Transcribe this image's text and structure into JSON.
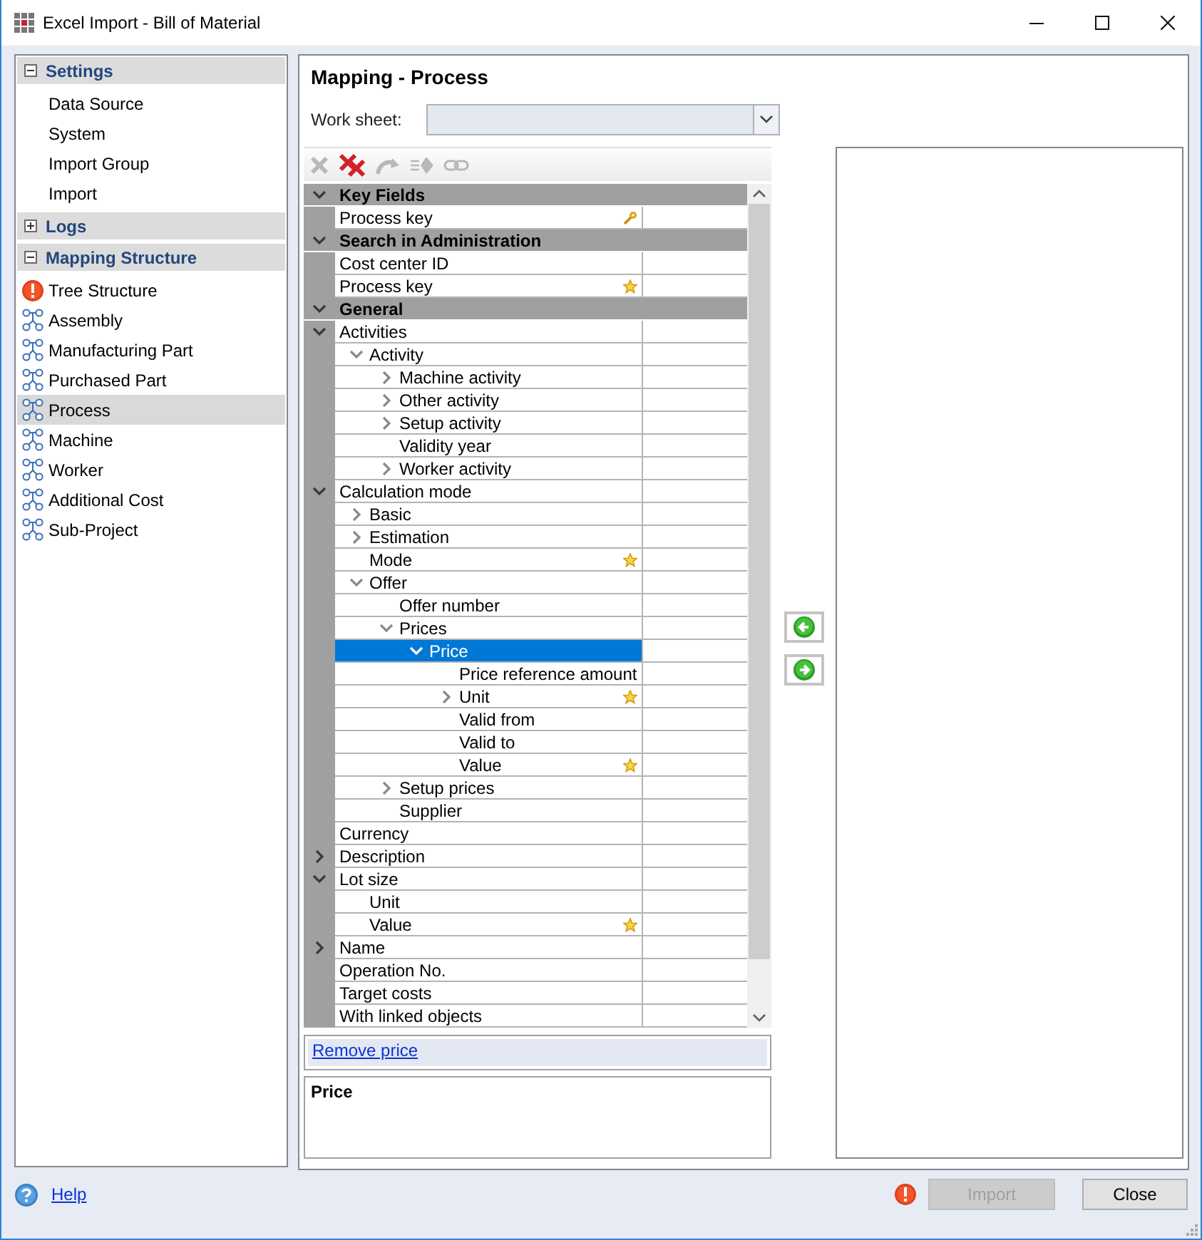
{
  "window": {
    "title": "Excel Import - Bill of Material"
  },
  "sidebar": {
    "sections": [
      {
        "title": "Settings",
        "expanded": true,
        "items": [
          {
            "label": "Data Source",
            "selected": false,
            "kind": "plain"
          },
          {
            "label": "System",
            "selected": false,
            "kind": "plain"
          },
          {
            "label": "Import Group",
            "selected": false,
            "kind": "plain"
          },
          {
            "label": "Import",
            "selected": false,
            "kind": "plain"
          }
        ]
      },
      {
        "title": "Logs",
        "expanded": false
      },
      {
        "title": "Mapping Structure",
        "expanded": true,
        "items": [
          {
            "label": "Tree Structure",
            "selected": false,
            "kind": "error"
          },
          {
            "label": "Assembly",
            "selected": false,
            "kind": "structure"
          },
          {
            "label": "Manufacturing Part",
            "selected": false,
            "kind": "structure"
          },
          {
            "label": "Purchased Part",
            "selected": false,
            "kind": "structure"
          },
          {
            "label": "Process",
            "selected": true,
            "kind": "structure"
          },
          {
            "label": "Machine",
            "selected": false,
            "kind": "structure"
          },
          {
            "label": "Worker",
            "selected": false,
            "kind": "structure"
          },
          {
            "label": "Additional Cost",
            "selected": false,
            "kind": "structure"
          },
          {
            "label": "Sub-Project",
            "selected": false,
            "kind": "structure"
          }
        ]
      }
    ]
  },
  "mapping": {
    "title": "Mapping - Process",
    "worksheet": {
      "label": "Work sheet:"
    },
    "toolbar": [
      {
        "kind": "delete",
        "disabled": true
      },
      {
        "kind": "delete-all",
        "disabled": false
      },
      {
        "kind": "undo",
        "disabled": true
      },
      {
        "kind": "assign",
        "disabled": true
      },
      {
        "kind": "link",
        "disabled": true
      }
    ],
    "groups": [
      {
        "title": "Key Fields",
        "expanded": true,
        "rows": [
          {
            "label": "Process key",
            "selected": false,
            "key_field": true
          }
        ]
      },
      {
        "title": "Search in Administration",
        "expanded": true,
        "rows": [
          {
            "label": "Cost center ID",
            "selected": false
          },
          {
            "label": "Process key",
            "selected": false,
            "required": true
          }
        ]
      },
      {
        "title": "General",
        "expanded": true,
        "rows": [
          {
            "label": "Activities",
            "selected": false,
            "expanded": true,
            "children": [
              {
                "label": "Activity",
                "selected": false,
                "expanded": true,
                "children": [
                  {
                    "label": "Machine activity",
                    "selected": false,
                    "expanded": false
                  },
                  {
                    "label": "Other activity",
                    "selected": false,
                    "expanded": false
                  },
                  {
                    "label": "Setup activity",
                    "selected": false,
                    "expanded": false
                  },
                  {
                    "label": "Validity year",
                    "selected": false
                  },
                  {
                    "label": "Worker activity",
                    "selected": false,
                    "expanded": false
                  }
                ]
              }
            ]
          },
          {
            "label": "Calculation mode",
            "selected": false,
            "expanded": true,
            "children": [
              {
                "label": "Basic",
                "selected": false,
                "expanded": false
              },
              {
                "label": "Estimation",
                "selected": false,
                "expanded": false
              },
              {
                "label": "Mode",
                "selected": false,
                "required": true
              },
              {
                "label": "Offer",
                "selected": false,
                "expanded": true,
                "children": [
                  {
                    "label": "Offer number",
                    "selected": false
                  },
                  {
                    "label": "Prices",
                    "selected": false,
                    "expanded": true,
                    "children": [
                      {
                        "label": "Price",
                        "selected": true,
                        "expanded": true,
                        "children": [
                          {
                            "label": "Price reference amount",
                            "selected": false
                          },
                          {
                            "label": "Unit",
                            "selected": false,
                            "expanded": false,
                            "required": true
                          },
                          {
                            "label": "Valid from",
                            "selected": false
                          },
                          {
                            "label": "Valid to",
                            "selected": false
                          },
                          {
                            "label": "Value",
                            "selected": false,
                            "required": true
                          }
                        ]
                      }
                    ]
                  },
                  {
                    "label": "Setup prices",
                    "selected": false,
                    "expanded": false
                  },
                  {
                    "label": "Supplier",
                    "selected": false
                  }
                ]
              }
            ]
          },
          {
            "label": "Currency",
            "selected": false
          },
          {
            "label": "Description",
            "selected": false,
            "expanded": false
          },
          {
            "label": "Lot size",
            "selected": false,
            "expanded": true,
            "children": [
              {
                "label": "Unit",
                "selected": false
              },
              {
                "label": "Value",
                "selected": false,
                "required": true
              }
            ]
          },
          {
            "label": "Name",
            "selected": false,
            "expanded": false
          },
          {
            "label": "Operation No.",
            "selected": false
          },
          {
            "label": "Target costs",
            "selected": false
          },
          {
            "label": "With linked objects",
            "selected": false
          }
        ]
      }
    ],
    "link": "Remove price",
    "description": {
      "title": "Price"
    },
    "transfer_buttons": [
      {
        "kind": "left"
      },
      {
        "kind": "right"
      }
    ]
  },
  "footer": {
    "help": "Help",
    "error": true,
    "buttons": [
      {
        "label": "Import",
        "disabled": true
      },
      {
        "label": "Close",
        "disabled": false
      }
    ]
  }
}
